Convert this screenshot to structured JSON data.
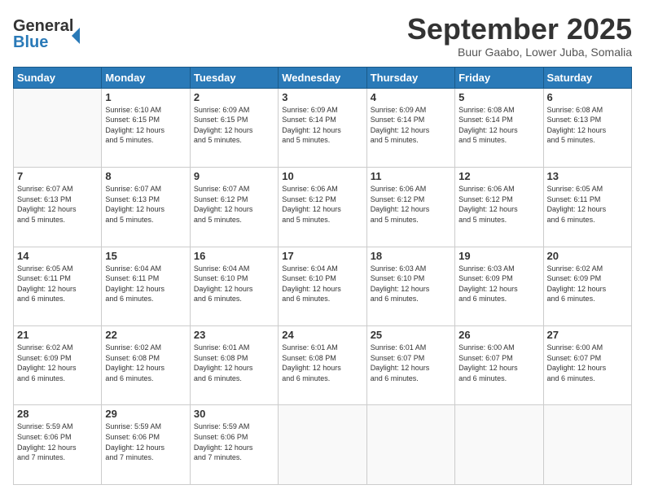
{
  "header": {
    "logo_line1": "General",
    "logo_line2": "Blue",
    "title": "September 2025",
    "subtitle": "Buur Gaabo, Lower Juba, Somalia"
  },
  "days_of_week": [
    "Sunday",
    "Monday",
    "Tuesday",
    "Wednesday",
    "Thursday",
    "Friday",
    "Saturday"
  ],
  "weeks": [
    [
      {
        "day": "",
        "info": ""
      },
      {
        "day": "1",
        "info": "Sunrise: 6:10 AM\nSunset: 6:15 PM\nDaylight: 12 hours\nand 5 minutes."
      },
      {
        "day": "2",
        "info": "Sunrise: 6:09 AM\nSunset: 6:15 PM\nDaylight: 12 hours\nand 5 minutes."
      },
      {
        "day": "3",
        "info": "Sunrise: 6:09 AM\nSunset: 6:14 PM\nDaylight: 12 hours\nand 5 minutes."
      },
      {
        "day": "4",
        "info": "Sunrise: 6:09 AM\nSunset: 6:14 PM\nDaylight: 12 hours\nand 5 minutes."
      },
      {
        "day": "5",
        "info": "Sunrise: 6:08 AM\nSunset: 6:14 PM\nDaylight: 12 hours\nand 5 minutes."
      },
      {
        "day": "6",
        "info": "Sunrise: 6:08 AM\nSunset: 6:13 PM\nDaylight: 12 hours\nand 5 minutes."
      }
    ],
    [
      {
        "day": "7",
        "info": "Sunrise: 6:07 AM\nSunset: 6:13 PM\nDaylight: 12 hours\nand 5 minutes."
      },
      {
        "day": "8",
        "info": "Sunrise: 6:07 AM\nSunset: 6:13 PM\nDaylight: 12 hours\nand 5 minutes."
      },
      {
        "day": "9",
        "info": "Sunrise: 6:07 AM\nSunset: 6:12 PM\nDaylight: 12 hours\nand 5 minutes."
      },
      {
        "day": "10",
        "info": "Sunrise: 6:06 AM\nSunset: 6:12 PM\nDaylight: 12 hours\nand 5 minutes."
      },
      {
        "day": "11",
        "info": "Sunrise: 6:06 AM\nSunset: 6:12 PM\nDaylight: 12 hours\nand 5 minutes."
      },
      {
        "day": "12",
        "info": "Sunrise: 6:06 AM\nSunset: 6:12 PM\nDaylight: 12 hours\nand 5 minutes."
      },
      {
        "day": "13",
        "info": "Sunrise: 6:05 AM\nSunset: 6:11 PM\nDaylight: 12 hours\nand 6 minutes."
      }
    ],
    [
      {
        "day": "14",
        "info": "Sunrise: 6:05 AM\nSunset: 6:11 PM\nDaylight: 12 hours\nand 6 minutes."
      },
      {
        "day": "15",
        "info": "Sunrise: 6:04 AM\nSunset: 6:11 PM\nDaylight: 12 hours\nand 6 minutes."
      },
      {
        "day": "16",
        "info": "Sunrise: 6:04 AM\nSunset: 6:10 PM\nDaylight: 12 hours\nand 6 minutes."
      },
      {
        "day": "17",
        "info": "Sunrise: 6:04 AM\nSunset: 6:10 PM\nDaylight: 12 hours\nand 6 minutes."
      },
      {
        "day": "18",
        "info": "Sunrise: 6:03 AM\nSunset: 6:10 PM\nDaylight: 12 hours\nand 6 minutes."
      },
      {
        "day": "19",
        "info": "Sunrise: 6:03 AM\nSunset: 6:09 PM\nDaylight: 12 hours\nand 6 minutes."
      },
      {
        "day": "20",
        "info": "Sunrise: 6:02 AM\nSunset: 6:09 PM\nDaylight: 12 hours\nand 6 minutes."
      }
    ],
    [
      {
        "day": "21",
        "info": "Sunrise: 6:02 AM\nSunset: 6:09 PM\nDaylight: 12 hours\nand 6 minutes."
      },
      {
        "day": "22",
        "info": "Sunrise: 6:02 AM\nSunset: 6:08 PM\nDaylight: 12 hours\nand 6 minutes."
      },
      {
        "day": "23",
        "info": "Sunrise: 6:01 AM\nSunset: 6:08 PM\nDaylight: 12 hours\nand 6 minutes."
      },
      {
        "day": "24",
        "info": "Sunrise: 6:01 AM\nSunset: 6:08 PM\nDaylight: 12 hours\nand 6 minutes."
      },
      {
        "day": "25",
        "info": "Sunrise: 6:01 AM\nSunset: 6:07 PM\nDaylight: 12 hours\nand 6 minutes."
      },
      {
        "day": "26",
        "info": "Sunrise: 6:00 AM\nSunset: 6:07 PM\nDaylight: 12 hours\nand 6 minutes."
      },
      {
        "day": "27",
        "info": "Sunrise: 6:00 AM\nSunset: 6:07 PM\nDaylight: 12 hours\nand 6 minutes."
      }
    ],
    [
      {
        "day": "28",
        "info": "Sunrise: 5:59 AM\nSunset: 6:06 PM\nDaylight: 12 hours\nand 7 minutes."
      },
      {
        "day": "29",
        "info": "Sunrise: 5:59 AM\nSunset: 6:06 PM\nDaylight: 12 hours\nand 7 minutes."
      },
      {
        "day": "30",
        "info": "Sunrise: 5:59 AM\nSunset: 6:06 PM\nDaylight: 12 hours\nand 7 minutes."
      },
      {
        "day": "",
        "info": ""
      },
      {
        "day": "",
        "info": ""
      },
      {
        "day": "",
        "info": ""
      },
      {
        "day": "",
        "info": ""
      }
    ]
  ]
}
